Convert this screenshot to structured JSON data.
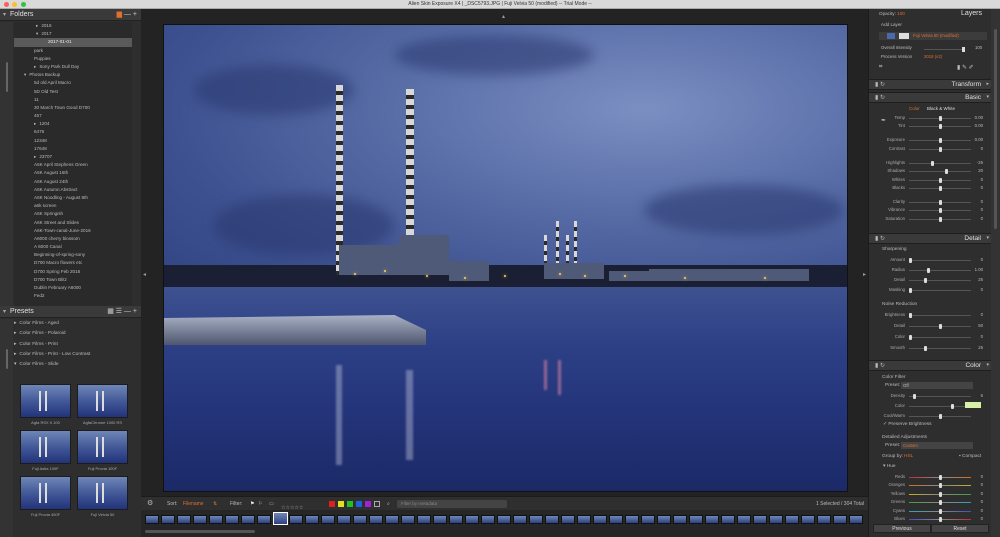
{
  "window": {
    "title": "Alien Skin Exposure X4 | _DSC5793.JPG | Fuji Velvia  50 (modified) -- Trial Mode --",
    "colors": {
      "close": "#ff5f57",
      "minimize": "#febc2e",
      "zoom": "#28c840"
    }
  },
  "folders": {
    "title": "Folders",
    "items": [
      {
        "label": "2016",
        "indent": 36,
        "arrow": "▸",
        "selected": false
      },
      {
        "label": "2017",
        "indent": 36,
        "arrow": "▾",
        "selected": false
      },
      {
        "label": "2017-01-01",
        "indent": 48,
        "arrow": "",
        "selected": true
      },
      {
        "label": "park",
        "indent": 34,
        "arrow": "",
        "selected": false
      },
      {
        "label": "Puppies",
        "indent": 34,
        "arrow": "",
        "selected": false
      },
      {
        "label": "Sony Park Dull Day",
        "indent": 34,
        "arrow": "▸",
        "selected": false
      },
      {
        "label": "Photos Backup",
        "indent": 24,
        "arrow": "▾",
        "selected": false
      },
      {
        "label": "5d old April Macro",
        "indent": 34,
        "arrow": "",
        "selected": false
      },
      {
        "label": "5D Old Test",
        "indent": 34,
        "arrow": "",
        "selected": false
      },
      {
        "label": "11",
        "indent": 34,
        "arrow": "",
        "selected": false
      },
      {
        "label": "30 March Town Good D700",
        "indent": 34,
        "arrow": "",
        "selected": false
      },
      {
        "label": "457",
        "indent": 34,
        "arrow": "",
        "selected": false
      },
      {
        "label": "1204",
        "indent": 34,
        "arrow": "▸",
        "selected": false
      },
      {
        "label": "6476",
        "indent": 34,
        "arrow": "",
        "selected": false
      },
      {
        "label": "12348",
        "indent": 34,
        "arrow": "",
        "selected": false
      },
      {
        "label": "17648",
        "indent": 34,
        "arrow": "",
        "selected": false
      },
      {
        "label": "23707",
        "indent": 34,
        "arrow": "▸",
        "selected": false
      },
      {
        "label": "A6K April Stephens Green",
        "indent": 34,
        "arrow": "",
        "selected": false
      },
      {
        "label": "A6K August 16th",
        "indent": 34,
        "arrow": "",
        "selected": false
      },
      {
        "label": "A6K August 24th",
        "indent": 34,
        "arrow": "",
        "selected": false
      },
      {
        "label": "A6K Autumn Abstract",
        "indent": 34,
        "arrow": "",
        "selected": false
      },
      {
        "label": "A6K Noodling - August 8th",
        "indent": 34,
        "arrow": "",
        "selected": false
      },
      {
        "label": "a6k screen",
        "indent": 34,
        "arrow": "",
        "selected": false
      },
      {
        "label": "A6K Springish",
        "indent": 34,
        "arrow": "",
        "selected": false
      },
      {
        "label": "A6K Street and Slides",
        "indent": 34,
        "arrow": "",
        "selected": false
      },
      {
        "label": "A6K-Town-canal-June-2016",
        "indent": 34,
        "arrow": "",
        "selected": false
      },
      {
        "label": "A6000 cherry blossom",
        "indent": 34,
        "arrow": "",
        "selected": false
      },
      {
        "label": "A 6000 Canal",
        "indent": 34,
        "arrow": "",
        "selected": false
      },
      {
        "label": "Beginning-of-spring-sony",
        "indent": 34,
        "arrow": "",
        "selected": false
      },
      {
        "label": "D700 Macro flowers etc",
        "indent": 34,
        "arrow": "",
        "selected": false
      },
      {
        "label": "D700 Spring Feb 2016",
        "indent": 34,
        "arrow": "",
        "selected": false
      },
      {
        "label": "D700 Town Blitz",
        "indent": 34,
        "arrow": "",
        "selected": false
      },
      {
        "label": "Dublin February A6000",
        "indent": 34,
        "arrow": "",
        "selected": false
      },
      {
        "label": "Fed2",
        "indent": 34,
        "arrow": "",
        "selected": false
      }
    ]
  },
  "presets": {
    "title": "Presets",
    "categories": [
      {
        "label": "Color Films - Aged",
        "arrow": "▸"
      },
      {
        "label": "Color Films - Polaroid",
        "arrow": "▸"
      },
      {
        "label": "Color Films - Print",
        "arrow": "▸"
      },
      {
        "label": "Color Films - Print - Low Contrast",
        "arrow": "▸"
      },
      {
        "label": "Color Films - Slide",
        "arrow": "▾"
      }
    ],
    "thumbs": [
      "Agfa RSX II 100",
      "AgfaChrome 1000 RS",
      "Fuji Astia 100F",
      "Fuji Provia 100F",
      "Fuji Provia 400F",
      "Fuji Velvia 50"
    ]
  },
  "toolbar": {
    "sort_label": "Sort:",
    "sort_value": "Filename",
    "filter_label": "Filter:",
    "stars": "☆☆☆☆☆",
    "filter_placeholder": "Filter by metadata",
    "selection_status": "1 Selected / 304 Total",
    "swatch_colors": [
      "#e02020",
      "#e0e020",
      "#20c020",
      "#2060e0",
      "#a020e0"
    ]
  },
  "right": {
    "opacity_label": "Opacity:",
    "opacity_value": "100",
    "layers_title": "Layers",
    "add_layer": "Add Layer",
    "layer_name": "Fuji Velvia 50 (modified)",
    "overall_intensity_label": "Overall Intensity",
    "overall_intensity_value": "100",
    "process_version_label": "Process Version",
    "process_version_value": "2018 (v2)",
    "transform_title": "Transform",
    "basic_title": "Basic",
    "color_tab": "Color",
    "bw_tab": "Black & White",
    "basic_rows": [
      {
        "label": "Temp",
        "value": "0.00",
        "pos": 0.5
      },
      {
        "label": "Tint",
        "value": "0.00",
        "pos": 0.5
      },
      {
        "label": "Exposure",
        "value": "0.00",
        "pos": 0.5
      },
      {
        "label": "Contrast",
        "value": "0",
        "pos": 0.5
      },
      {
        "label": "Highlights",
        "value": "-26",
        "pos": 0.37
      },
      {
        "label": "Shadows",
        "value": "20",
        "pos": 0.6
      },
      {
        "label": "Whites",
        "value": "0",
        "pos": 0.5
      },
      {
        "label": "Blacks",
        "value": "0",
        "pos": 0.5
      },
      {
        "label": "Clarity",
        "value": "0",
        "pos": 0.5
      },
      {
        "label": "Vibrance",
        "value": "0",
        "pos": 0.5
      },
      {
        "label": "Saturation",
        "value": "0",
        "pos": 0.5
      }
    ],
    "detail_title": "Detail",
    "sharpening_label": "Sharpening",
    "sharp_rows": [
      {
        "label": "Amount",
        "value": "0",
        "pos": 0.0
      },
      {
        "label": "Radius",
        "value": "1.00",
        "pos": 0.3
      },
      {
        "label": "Detail",
        "value": "25",
        "pos": 0.25
      },
      {
        "label": "Masking",
        "value": "0",
        "pos": 0.0
      }
    ],
    "noise_label": "Noise Reduction",
    "noise_rows": [
      {
        "label": "Brightness",
        "value": "0",
        "pos": 0.0
      },
      {
        "label": "Detail",
        "value": "50",
        "pos": 0.5
      },
      {
        "label": "Color",
        "value": "0",
        "pos": 0.0
      },
      {
        "label": "Smooth",
        "value": "25",
        "pos": 0.25
      }
    ],
    "color_title": "Color",
    "color_filter_label": "Color Filter",
    "preset_label": "Preset:",
    "preset_value": "Off",
    "cf_rows": [
      {
        "label": "Density",
        "value": "6",
        "pos": 0.06
      },
      {
        "label": "Color",
        "value": "",
        "pos": 0.7
      },
      {
        "label": "Cool/Warm",
        "value": "",
        "pos": 0.5
      }
    ],
    "preserve_brightness": "Preserve Brightness",
    "detailed_adj_label": "Detailed Adjustments",
    "preset2_value": "Custom",
    "group_by_label": "Group by:",
    "group_by_value": "HSL",
    "compact_label": "Compact",
    "hue_label": "Hue",
    "hue_rows": [
      "Reds",
      "Oranges",
      "Yellows",
      "Greens",
      "Cyans",
      "Blues"
    ],
    "previous_btn": "Previous",
    "reset_btn": "Reset"
  }
}
